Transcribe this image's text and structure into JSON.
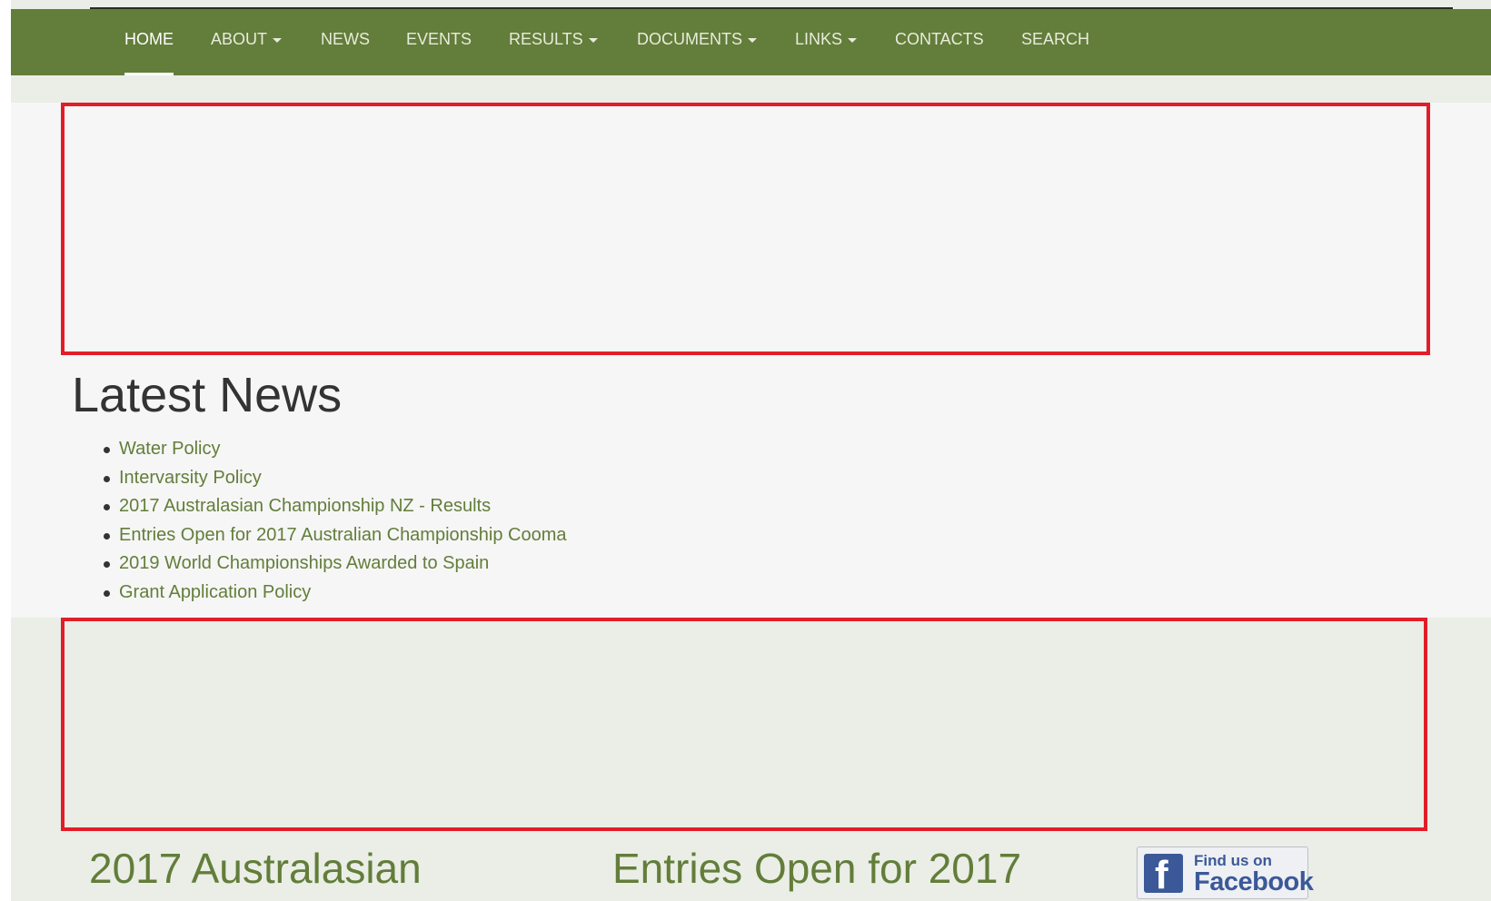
{
  "nav": {
    "items": [
      {
        "label": "HOME",
        "dropdown": false,
        "active": true
      },
      {
        "label": "ABOUT",
        "dropdown": true,
        "active": false
      },
      {
        "label": "NEWS",
        "dropdown": false,
        "active": false
      },
      {
        "label": "EVENTS",
        "dropdown": false,
        "active": false
      },
      {
        "label": "RESULTS",
        "dropdown": true,
        "active": false
      },
      {
        "label": "DOCUMENTS",
        "dropdown": true,
        "active": false
      },
      {
        "label": "LINKS",
        "dropdown": true,
        "active": false
      },
      {
        "label": "CONTACTS",
        "dropdown": false,
        "active": false
      },
      {
        "label": "SEARCH",
        "dropdown": false,
        "active": false
      }
    ]
  },
  "latest_news": {
    "title": "Latest News",
    "items": [
      "Water Policy",
      "Intervarsity Policy",
      "2017 Australasian Championship NZ - Results",
      "Entries Open for 2017 Australian Championship Cooma",
      "2019 World Championships Awarded to Spain",
      "Grant Application Policy"
    ]
  },
  "features": [
    {
      "title": "2017 Australasian"
    },
    {
      "title": "Entries Open for 2017"
    }
  ],
  "facebook": {
    "line1": "Find us on",
    "line2": "Facebook",
    "icon": "facebook-icon"
  },
  "colors": {
    "brand_green": "#637d3a",
    "placeholder_border": "#e21d2a"
  }
}
